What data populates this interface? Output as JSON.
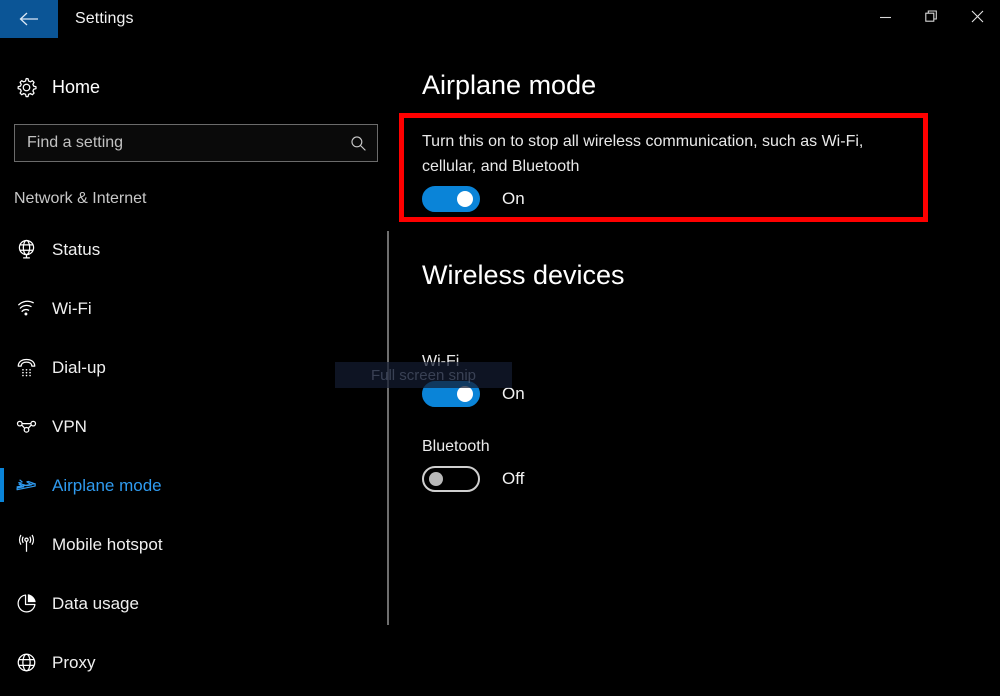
{
  "window": {
    "title": "Settings",
    "back_icon": "back-arrow-icon",
    "controls": {
      "minimize": "minimize-icon",
      "restore": "restore-icon",
      "close": "close-icon"
    }
  },
  "sidebar": {
    "home": {
      "label": "Home",
      "icon": "gear-icon"
    },
    "search": {
      "placeholder": "Find a setting",
      "value": "",
      "icon": "search-icon"
    },
    "section_header": "Network & Internet",
    "items": [
      {
        "label": "Status",
        "icon": "globe-icon",
        "selected": false
      },
      {
        "label": "Wi-Fi",
        "icon": "wifi-icon",
        "selected": false
      },
      {
        "label": "Dial-up",
        "icon": "telephone-icon",
        "selected": false
      },
      {
        "label": "VPN",
        "icon": "vpn-icon",
        "selected": false
      },
      {
        "label": "Airplane mode",
        "icon": "airplane-icon",
        "selected": true
      },
      {
        "label": "Mobile hotspot",
        "icon": "hotspot-icon",
        "selected": false
      },
      {
        "label": "Data usage",
        "icon": "pie-chart-icon",
        "selected": false
      },
      {
        "label": "Proxy",
        "icon": "globe-icon",
        "selected": false
      }
    ]
  },
  "main": {
    "page_title": "Airplane mode",
    "airplane": {
      "description": "Turn this on to stop all wireless communication, such as Wi-Fi, cellular, and Bluetooth",
      "state": "On"
    },
    "wireless_devices": {
      "title": "Wireless devices",
      "devices": [
        {
          "label": "Wi-Fi",
          "state": "On"
        },
        {
          "label": "Bluetooth",
          "state": "Off"
        }
      ]
    }
  },
  "overlay": {
    "snip_ghost_text": "Full screen snip"
  },
  "colors": {
    "accent_blue": "#0a84d8",
    "selected_text_blue": "#2f9bf0",
    "titlebar_back_blue": "#0b5596",
    "highlight_red": "#fe0000",
    "background": "#000000"
  }
}
